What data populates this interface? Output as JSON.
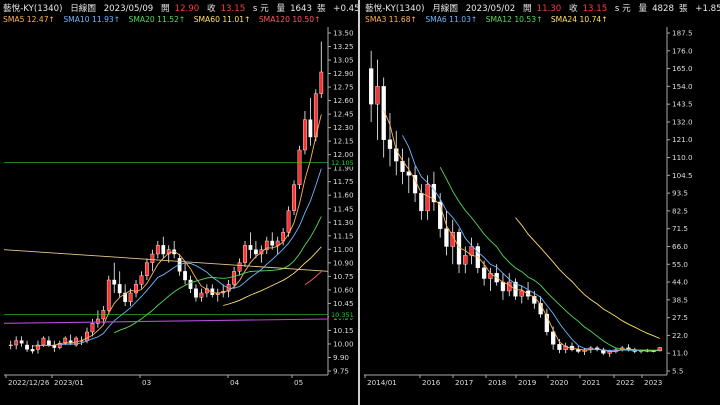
{
  "left": {
    "header": {
      "name": "藝悅-KY(1340)",
      "period": "日線圖",
      "date": "2023/05/09",
      "open_label": "開",
      "open": "12.90",
      "close_label": "收",
      "close": "13.15",
      "unit": "s 元",
      "vol_label": "量",
      "volume": "1643",
      "vol_unit": "張",
      "change": "+0.45 (+3.54%)"
    },
    "ma": [
      {
        "label": "SMA5 12.47↑",
        "color": "#ffb35a"
      },
      {
        "label": "SMA10 11.93↑",
        "color": "#6fb7ff"
      },
      {
        "label": "SMA20 11.52↑",
        "color": "#57d957"
      },
      {
        "label": "SMA60 11.01↑",
        "color": "#ffe066"
      },
      {
        "label": "SMA120 10.50↑",
        "color": "#ff5b5b"
      }
    ],
    "chart_data": {
      "type": "candlestick",
      "y_ticks": [
        "13.50",
        "13.25",
        "13.05",
        "12.90",
        "12.75",
        "12.60",
        "12.45",
        "12.30",
        "12.15",
        "12.00",
        "11.90",
        "11.75",
        "11.60",
        "11.45",
        "11.30",
        "11.15",
        "11.00",
        "10.90",
        "10.75",
        "10.60",
        "10.45",
        "10.30",
        "10.15",
        "10.00",
        "9.90",
        "9.75"
      ],
      "ylim": [
        9.7,
        13.6
      ],
      "x_labels": [
        "2022/12/26",
        "2023/01",
        "03",
        "04",
        "05"
      ],
      "price_tags": [
        "12.105",
        "10.351"
      ],
      "candles": [
        [
          10.0,
          10.05,
          9.95,
          10.0
        ],
        [
          10.0,
          10.1,
          9.95,
          10.05
        ],
        [
          10.05,
          10.1,
          9.98,
          10.02
        ],
        [
          10.0,
          10.05,
          9.92,
          9.95
        ],
        [
          9.95,
          10.0,
          9.9,
          9.93
        ],
        [
          9.95,
          10.05,
          9.9,
          10.0
        ],
        [
          10.0,
          10.1,
          9.98,
          10.08
        ],
        [
          10.05,
          10.1,
          9.98,
          10.0
        ],
        [
          10.0,
          10.05,
          9.92,
          9.97
        ],
        [
          9.97,
          10.05,
          9.95,
          10.02
        ],
        [
          10.02,
          10.1,
          10.0,
          10.08
        ],
        [
          10.05,
          10.12,
          10.0,
          10.03
        ],
        [
          10.0,
          10.1,
          9.98,
          10.08
        ],
        [
          10.05,
          10.1,
          10.0,
          10.05
        ],
        [
          10.05,
          10.2,
          10.02,
          10.15
        ],
        [
          10.15,
          10.3,
          10.1,
          10.25
        ],
        [
          10.25,
          10.4,
          10.2,
          10.3
        ],
        [
          10.3,
          10.45,
          10.25,
          10.4
        ],
        [
          10.4,
          10.8,
          10.35,
          10.75
        ],
        [
          10.75,
          10.95,
          10.6,
          10.7
        ],
        [
          10.7,
          10.85,
          10.55,
          10.6
        ],
        [
          10.6,
          10.7,
          10.45,
          10.5
        ],
        [
          10.5,
          10.65,
          10.45,
          10.6
        ],
        [
          10.6,
          10.75,
          10.55,
          10.7
        ],
        [
          10.7,
          10.85,
          10.65,
          10.8
        ],
        [
          10.8,
          11.0,
          10.75,
          10.95
        ],
        [
          10.95,
          11.1,
          10.85,
          11.05
        ],
        [
          11.05,
          11.2,
          11.0,
          11.15
        ],
        [
          11.15,
          11.25,
          11.0,
          11.05
        ],
        [
          11.05,
          11.15,
          10.95,
          11.1
        ],
        [
          11.1,
          11.2,
          11.0,
          11.05
        ],
        [
          11.0,
          11.05,
          10.8,
          10.85
        ],
        [
          10.85,
          10.95,
          10.7,
          10.75
        ],
        [
          10.75,
          10.8,
          10.6,
          10.65
        ],
        [
          10.65,
          10.7,
          10.5,
          10.55
        ],
        [
          10.55,
          10.65,
          10.5,
          10.6
        ],
        [
          10.6,
          10.7,
          10.55,
          10.65
        ],
        [
          10.65,
          10.7,
          10.55,
          10.58
        ],
        [
          10.58,
          10.65,
          10.5,
          10.6
        ],
        [
          10.6,
          10.7,
          10.55,
          10.62
        ],
        [
          10.62,
          10.75,
          10.55,
          10.7
        ],
        [
          10.7,
          10.9,
          10.65,
          10.85
        ],
        [
          10.85,
          11.0,
          10.8,
          10.95
        ],
        [
          10.95,
          11.2,
          10.9,
          11.15
        ],
        [
          11.15,
          11.3,
          11.0,
          11.1
        ],
        [
          11.1,
          11.2,
          11.0,
          11.05
        ],
        [
          11.05,
          11.15,
          10.95,
          11.1
        ],
        [
          11.1,
          11.25,
          11.05,
          11.2
        ],
        [
          11.2,
          11.3,
          11.1,
          11.15
        ],
        [
          11.15,
          11.25,
          11.05,
          11.2
        ],
        [
          11.2,
          11.35,
          11.15,
          11.3
        ],
        [
          11.3,
          11.6,
          11.25,
          11.55
        ],
        [
          11.55,
          11.9,
          11.5,
          11.85
        ],
        [
          11.85,
          12.3,
          11.8,
          12.25
        ],
        [
          12.25,
          12.7,
          12.2,
          12.6
        ],
        [
          12.6,
          12.85,
          12.3,
          12.4
        ],
        [
          12.4,
          12.95,
          12.35,
          12.9
        ],
        [
          12.9,
          13.5,
          12.85,
          13.15
        ]
      ]
    }
  },
  "right": {
    "header": {
      "name": "藝悅-KY(1340)",
      "period": "月線圖",
      "date": "2023/05/02",
      "open_label": "開",
      "open": "11.30",
      "close_label": "收",
      "close": "13.15",
      "unit": "s 元",
      "vol_label": "量",
      "volume": "4828",
      "vol_unit": "張",
      "change": "+1.85 (+16.37%)"
    },
    "ma": [
      {
        "label": "SMA3 11.68↑",
        "color": "#ffb35a"
      },
      {
        "label": "SMA6 11.03↑",
        "color": "#6fb7ff"
      },
      {
        "label": "SMA12 10.53↑",
        "color": "#57d957"
      },
      {
        "label": "SMA24 10.74↑",
        "color": "#ffe066"
      }
    ],
    "chart_data": {
      "type": "candlestick",
      "y_ticks": [
        "187.5",
        "176.0",
        "165.0",
        "154.0",
        "143.5",
        "132.0",
        "121.0",
        "110.0",
        "104.5",
        "93.5",
        "82.5",
        "71.5",
        "66.0",
        "55.0",
        "44.0",
        "38.5",
        "27.5",
        "22.0",
        "11.0",
        "5.5"
      ],
      "ylim": [
        0,
        190
      ],
      "x_labels": [
        "2014/01",
        "2016",
        "2017",
        "2018",
        "2019",
        "2020",
        "2021",
        "2022",
        "2023"
      ],
      "candles": [
        [
          170,
          180,
          140,
          150
        ],
        [
          150,
          175,
          130,
          160
        ],
        [
          160,
          165,
          120,
          130
        ],
        [
          130,
          145,
          115,
          125
        ],
        [
          125,
          135,
          110,
          118
        ],
        [
          118,
          125,
          105,
          112
        ],
        [
          112,
          120,
          100,
          110
        ],
        [
          110,
          115,
          95,
          100
        ],
        [
          100,
          105,
          85,
          90
        ],
        [
          90,
          110,
          85,
          105
        ],
        [
          105,
          112,
          90,
          95
        ],
        [
          95,
          100,
          75,
          80
        ],
        [
          80,
          90,
          65,
          70
        ],
        [
          70,
          85,
          60,
          78
        ],
        [
          78,
          80,
          55,
          60
        ],
        [
          60,
          70,
          55,
          65
        ],
        [
          65,
          75,
          60,
          70
        ],
        [
          70,
          72,
          55,
          58
        ],
        [
          58,
          62,
          48,
          52
        ],
        [
          52,
          58,
          45,
          55
        ],
        [
          55,
          60,
          48,
          50
        ],
        [
          50,
          55,
          40,
          45
        ],
        [
          45,
          55,
          42,
          50
        ],
        [
          50,
          52,
          40,
          42
        ],
        [
          42,
          48,
          38,
          45
        ],
        [
          45,
          50,
          40,
          42
        ],
        [
          42,
          45,
          35,
          38
        ],
        [
          38,
          42,
          30,
          32
        ],
        [
          32,
          35,
          20,
          22
        ],
        [
          22,
          25,
          12,
          15
        ],
        [
          15,
          18,
          10,
          12
        ],
        [
          12,
          16,
          10,
          14
        ],
        [
          14,
          16,
          11,
          12
        ],
        [
          12,
          14,
          10,
          11
        ],
        [
          11,
          13,
          9,
          12
        ],
        [
          12,
          14,
          10,
          13
        ],
        [
          13,
          14,
          11,
          12
        ],
        [
          12,
          13,
          9,
          10
        ],
        [
          10,
          12,
          8,
          11
        ],
        [
          11,
          13,
          10,
          12
        ],
        [
          12,
          14,
          11,
          13
        ],
        [
          13,
          15,
          11,
          12
        ],
        [
          12,
          13,
          10,
          11
        ],
        [
          11,
          12,
          10,
          11.5
        ],
        [
          11.5,
          12.5,
          10.5,
          11
        ],
        [
          11,
          12,
          10.5,
          11.3
        ],
        [
          11.3,
          13.5,
          11,
          13.15
        ]
      ]
    }
  }
}
